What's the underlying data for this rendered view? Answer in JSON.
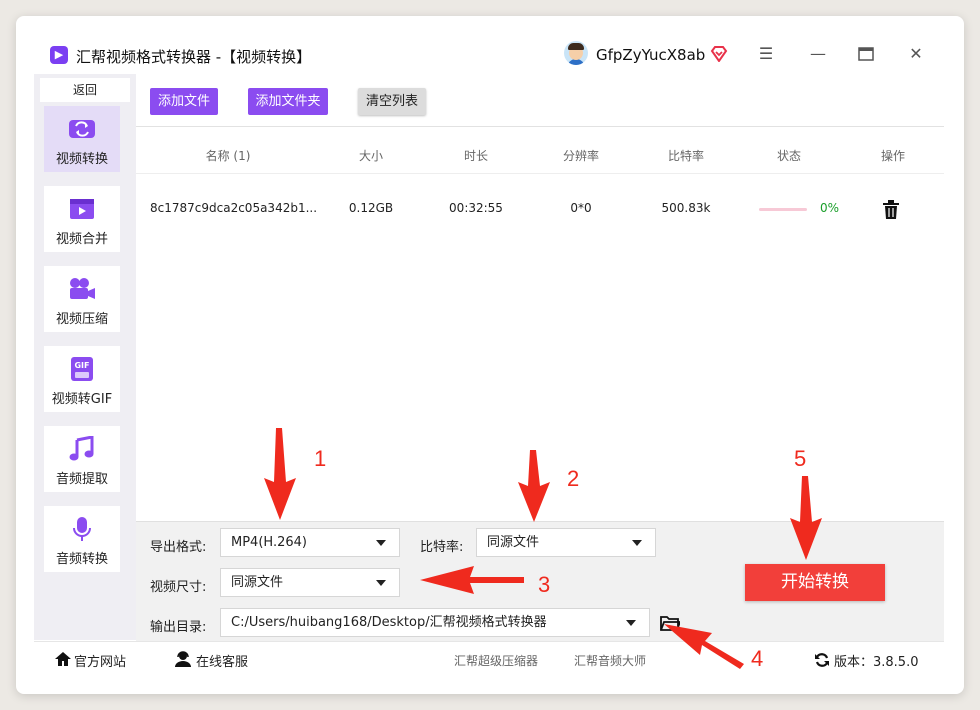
{
  "window": {
    "title": "汇帮视频格式转换器 -【视频转换】",
    "username": "GfpZyYucX8ab"
  },
  "sidebar": {
    "back_label": "返回",
    "items": [
      {
        "label": "视频转换",
        "icon": "video-convert-icon",
        "active": true
      },
      {
        "label": "视频合并",
        "icon": "video-merge-icon",
        "active": false
      },
      {
        "label": "视频压缩",
        "icon": "video-compress-icon",
        "active": false
      },
      {
        "label": "视频转GIF",
        "icon": "gif-icon",
        "active": false
      },
      {
        "label": "音频提取",
        "icon": "music-note-icon",
        "active": false
      },
      {
        "label": "音频转换",
        "icon": "microphone-icon",
        "active": false
      }
    ]
  },
  "toolbar": {
    "add_file": "添加文件",
    "add_folder": "添加文件夹",
    "clear_list": "清空列表"
  },
  "table": {
    "headers": [
      "名称 (1)",
      "大小",
      "时长",
      "分辨率",
      "比特率",
      "状态",
      "操作"
    ],
    "rows": [
      {
        "name": "8c1787c9dca2c05a342b1...",
        "size": "0.12GB",
        "duration": "00:32:55",
        "resolution": "0*0",
        "bitrate": "500.83k",
        "progress_percent": 0,
        "progress_text": "0%"
      }
    ]
  },
  "settings": {
    "format_label": "导出格式:",
    "format_value": "MP4(H.264)",
    "bitrate_label": "比特率:",
    "bitrate_value": "同源文件",
    "size_label": "视频尺寸:",
    "size_value": "同源文件",
    "output_label": "输出目录:",
    "output_value": "C:/Users/huibang168/Desktop/汇帮视频格式转换器",
    "start_button": "开始转换"
  },
  "footer": {
    "website": "官方网站",
    "support": "在线客服",
    "link1": "汇帮超级压缩器",
    "link2": "汇帮音频大师",
    "version": "版本：3.8.5.0"
  },
  "annotations": [
    "1",
    "2",
    "3",
    "4",
    "5"
  ],
  "colors": {
    "accent_purple": "#8b4cf0",
    "start_red": "#f23f3a",
    "annotation_red": "#ef2a1e",
    "progress_green": "#1a9e2a"
  }
}
